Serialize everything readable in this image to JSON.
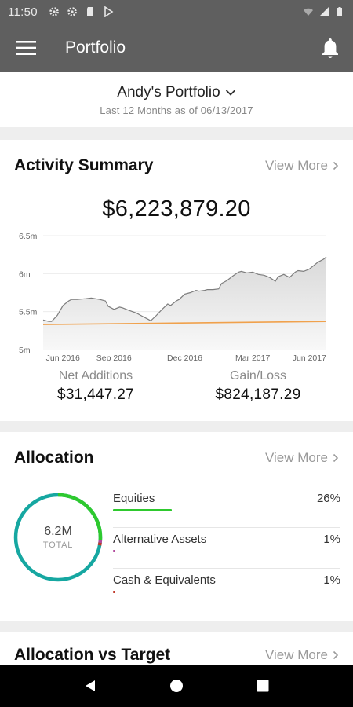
{
  "status_bar": {
    "time": "11:50"
  },
  "app_bar": {
    "title": "Portfolio"
  },
  "portfolio": {
    "name": "Andy's Portfolio",
    "subtitle": "Last 12 Months as of 06/13/2017"
  },
  "activity_summary": {
    "title": "Activity Summary",
    "view_more": "View More",
    "total": "$6,223,879.20",
    "net_additions_label": "Net Additions",
    "net_additions_value": "$31,447.27",
    "gain_loss_label": "Gain/Loss",
    "gain_loss_value": "$824,187.29"
  },
  "chart_data": {
    "type": "area",
    "ytick_labels": [
      "6.5m",
      "6m",
      "5.5m",
      "5m"
    ],
    "yticks": [
      6.5,
      6.0,
      5.5,
      5.0
    ],
    "xtick_labels": [
      "Jun 2016",
      "Sep 2016",
      "Dec 2016",
      "Mar 2017",
      "Jun 2017"
    ],
    "ylim": [
      5.0,
      6.5
    ],
    "series": [
      {
        "type": "area",
        "color": "#7d7d7d",
        "x": [
          0,
          0.02,
          0.03,
          0.05,
          0.07,
          0.09,
          0.1,
          0.12,
          0.15,
          0.17,
          0.2,
          0.22,
          0.23,
          0.25,
          0.27,
          0.28,
          0.3,
          0.33,
          0.35,
          0.37,
          0.38,
          0.4,
          0.42,
          0.44,
          0.45,
          0.47,
          0.48,
          0.5,
          0.52,
          0.54,
          0.55,
          0.57,
          0.58,
          0.6,
          0.62,
          0.63,
          0.65,
          0.67,
          0.69,
          0.7,
          0.72,
          0.74,
          0.76,
          0.78,
          0.8,
          0.82,
          0.83,
          0.85,
          0.87,
          0.89,
          0.9,
          0.92,
          0.94,
          0.96,
          0.97,
          0.99,
          1.0
        ],
        "values": [
          5.39,
          5.37,
          5.37,
          5.45,
          5.58,
          5.64,
          5.66,
          5.66,
          5.67,
          5.68,
          5.66,
          5.64,
          5.57,
          5.53,
          5.56,
          5.55,
          5.52,
          5.48,
          5.44,
          5.4,
          5.38,
          5.45,
          5.53,
          5.6,
          5.58,
          5.64,
          5.66,
          5.73,
          5.75,
          5.78,
          5.77,
          5.78,
          5.79,
          5.79,
          5.8,
          5.87,
          5.91,
          5.97,
          6.02,
          6.03,
          6.01,
          6.02,
          5.99,
          5.98,
          5.95,
          5.9,
          5.96,
          5.99,
          5.95,
          6.02,
          6.04,
          6.03,
          6.06,
          6.12,
          6.15,
          6.19,
          6.22
        ]
      },
      {
        "type": "line",
        "color": "#f0a14c",
        "x": [
          0,
          1.0
        ],
        "values": [
          5.33,
          5.37
        ]
      }
    ]
  },
  "allocation": {
    "title": "Allocation",
    "view_more": "View More",
    "total_value": "6.2M",
    "total_label": "TOTAL",
    "items": [
      {
        "name": "Equities",
        "percent": "26%",
        "fraction": 0.26,
        "color": "#2ec92e"
      },
      {
        "name": "Alternative Assets",
        "percent": "1%",
        "fraction": 0.01,
        "color": "#b14a9c"
      },
      {
        "name": "Cash & Equivalents",
        "percent": "1%",
        "fraction": 0.01,
        "color": "#c0392b"
      }
    ],
    "main_color": "#16a7a1"
  },
  "allocation_vs_target": {
    "title": "Allocation vs Target",
    "view_more": "View More"
  }
}
